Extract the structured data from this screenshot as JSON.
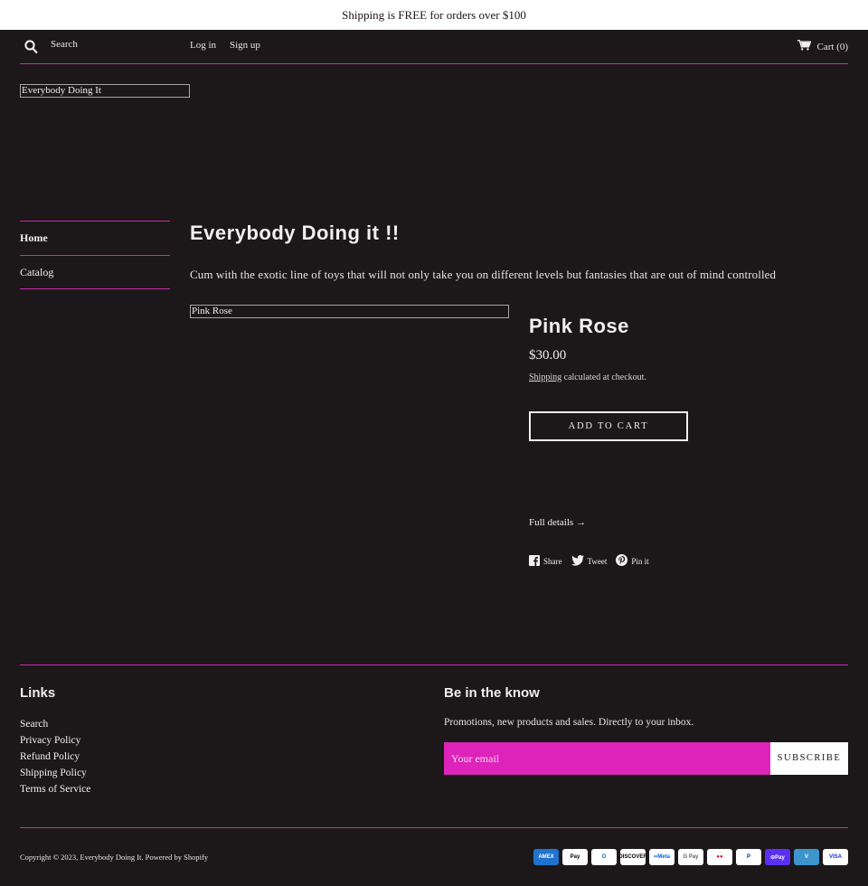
{
  "announcement": "Shipping is FREE for orders over $100",
  "header": {
    "search_label": "Search",
    "login": "Log in",
    "signup": "Sign up",
    "cart_label": "Cart (0)"
  },
  "logo_alt": "Everybody Doing It",
  "sidebar": {
    "items": [
      {
        "label": "Home",
        "active": true
      },
      {
        "label": "Catalog",
        "active": false
      }
    ]
  },
  "page": {
    "title": "Everybody Doing it !!",
    "description": "Cum with the exotic line of toys that will not only take you on different levels but fantasies that are out of mind controlled"
  },
  "product": {
    "image_alt": "Pink Rose",
    "name": "Pink Rose",
    "price": "$30.00",
    "shipping_link": "Shipping",
    "shipping_rest": " calculated at checkout.",
    "add_to_cart": "ADD TO CART",
    "full_details": "Full details →",
    "share": "Share",
    "tweet": "Tweet",
    "pin": "Pin it"
  },
  "footer": {
    "links_heading": "Links",
    "links": [
      "Search",
      "Privacy Policy",
      "Refund Policy",
      "Shipping Policy",
      "Terms of Service"
    ],
    "newsletter_heading": "Be in the know",
    "newsletter_text": "Promotions, new products and sales. Directly to your inbox.",
    "email_placeholder": "Your email",
    "subscribe": "SUBSCRIBE",
    "copyright": "Copyright © 2023, Everybody Doing It. Powered by Shopify",
    "payments": [
      {
        "name": "American Express",
        "text": "AMEX",
        "bg": "#1f72cd",
        "fg": "#ffffff"
      },
      {
        "name": "Apple Pay",
        "text": " Pay",
        "bg": "#ffffff",
        "fg": "#000000"
      },
      {
        "name": "Diners Club",
        "text": "D",
        "bg": "#ffffff",
        "fg": "#0079be"
      },
      {
        "name": "Discover",
        "text": "DISCOVER",
        "bg": "#ffffff",
        "fg": "#000000"
      },
      {
        "name": "Meta Pay",
        "text": "∞Meta",
        "bg": "#ffffff",
        "fg": "#0064e0"
      },
      {
        "name": "Google Pay",
        "text": "G Pay",
        "bg": "#ffffff",
        "fg": "#5f6368"
      },
      {
        "name": "Mastercard",
        "text": "●●",
        "bg": "#ffffff",
        "fg": "#eb001b"
      },
      {
        "name": "PayPal",
        "text": "P",
        "bg": "#ffffff",
        "fg": "#003087"
      },
      {
        "name": "Shop Pay",
        "text": "⊖Pay",
        "bg": "#5a31f4",
        "fg": "#ffffff"
      },
      {
        "name": "Venmo",
        "text": "V",
        "bg": "#3d95ce",
        "fg": "#ffffff"
      },
      {
        "name": "Visa",
        "text": "VISA",
        "bg": "#ffffff",
        "fg": "#1434cb"
      }
    ]
  },
  "colors": {
    "background": "#1c1718",
    "accent": "#c92bb0",
    "email_field": "#dd23b9"
  }
}
